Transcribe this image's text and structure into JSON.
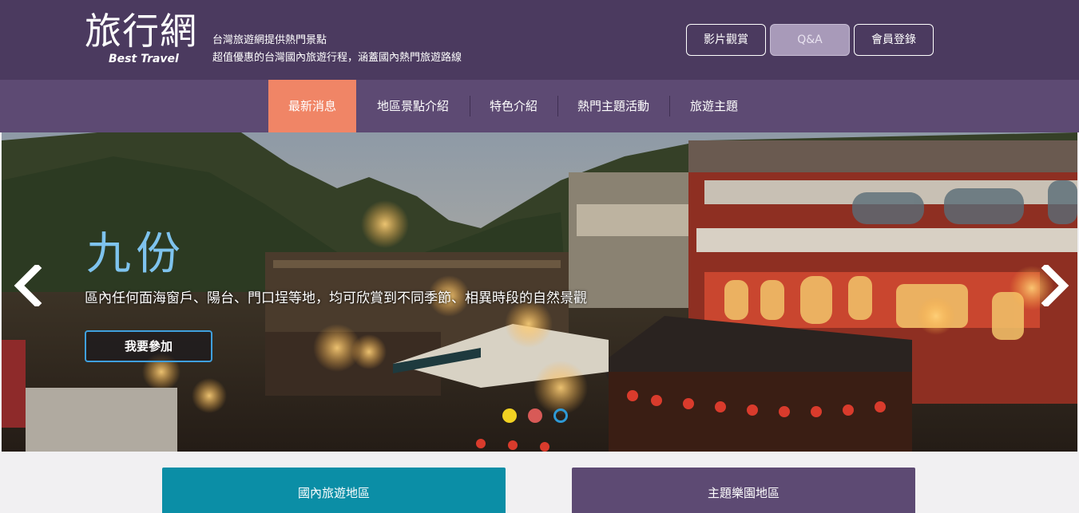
{
  "header": {
    "logo_main": "旅行網",
    "logo_sub": "Best Travel",
    "tagline_line1": "台灣旅遊網提供熱門景點",
    "tagline_line2": "超值優惠的台灣國內旅遊行程，涵蓋國內熱門旅遊路線",
    "buttons": [
      {
        "label": "影片觀賞"
      },
      {
        "label": "Q&A"
      },
      {
        "label": "會員登錄"
      }
    ]
  },
  "nav": {
    "items": [
      {
        "label": "最新消息"
      },
      {
        "label": "地區景點介紹"
      },
      {
        "label": "特色介紹"
      },
      {
        "label": "熱門主題活動"
      },
      {
        "label": "旅遊主題"
      }
    ],
    "active_index": 0
  },
  "hero": {
    "title": "九份",
    "description": "區內任何面海窗戶、陽台、門口埕等地，均可欣賞到不同季節、相異時段的自然景觀",
    "cta": "我要參加",
    "dots": [
      {
        "color": "#f2d222"
      },
      {
        "color": "#d85a57"
      },
      {
        "color": "#2e9ad6"
      }
    ],
    "active_dot": 2
  },
  "cards": [
    {
      "label": "國內旅遊地區",
      "color": "#0b8ea6"
    },
    {
      "label": "主題樂園地區",
      "color": "#5d4a73"
    }
  ],
  "colors": {
    "header_bg": "#4b3a5f",
    "nav_bg": "#5d4a73",
    "nav_active": "#f08566",
    "accent_blue": "#3fa0de"
  },
  "icons": {
    "prev": "chevron-left-icon",
    "next": "chevron-right-icon"
  }
}
